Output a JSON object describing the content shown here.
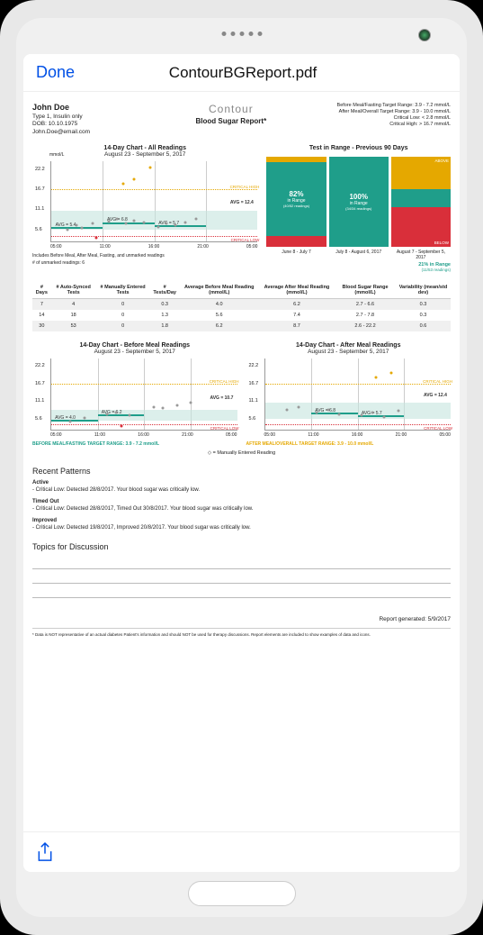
{
  "header": {
    "done": "Done",
    "title": "ContourBGReport.pdf"
  },
  "patient": {
    "name": "John Doe",
    "type": "Type 1, Insulin only",
    "dob": "DOB: 10.10.1975",
    "email": "John.Doe@email.com"
  },
  "brand": {
    "logo": "Contour",
    "subtitle": "Blood Sugar Report*"
  },
  "targets": {
    "before": "Before Meal/Fasting Target Range:  3.9 - 7.2 mmol/L",
    "after": "After Meal/Overall Target Range:  3.9 - 10.0 mmol/L",
    "low": "Critical Low:  < 2.8 mmol/L",
    "high": "Critical High:  > 16.7 mmol/L"
  },
  "chart_all": {
    "title": "14-Day Chart - All Readings",
    "subtitle": "August 23 - September 5, 2017",
    "unit": "mmol/L",
    "note1": "Includes Before Meal, After Meal, Fasting, and unmarked readings",
    "note2": "# of unmarked readings:  6",
    "crit_high": "CRITICAL HIGH",
    "crit_low": "CRITICAL LOW",
    "avg_label": "AVG = 12.4"
  },
  "chart_range": {
    "title": "Test in Range - Previous 90 Days",
    "col1": {
      "pct": "82%",
      "sub": "in Range",
      "small": "(40/52 readings)",
      "label": "June 8 - July 7"
    },
    "col2": {
      "pct": "100%",
      "sub": "in Range",
      "small": "(34/34 readings)",
      "label": "July 8 - August 6, 2017"
    },
    "col3": {
      "above": "ABOVE",
      "below": "BELOW",
      "label": "August 7 - September 5, 2017"
    },
    "note": "21% in Range",
    "note2": "(11/53 readings)"
  },
  "table": {
    "headers": [
      "# Days",
      "# Auto-Synced Tests",
      "# Manually Entered Tests",
      "# Tests/Day",
      "Average Before Meal Reading (mmol/L)",
      "Average After Meal Reading (mmol/L)",
      "Blood Sugar Range (mmol/L)",
      "Variability (mean/std dev)"
    ],
    "rows": [
      [
        "7",
        "4",
        "0",
        "0.3",
        "4.0",
        "6.2",
        "2.7 - 6.6",
        "0.3"
      ],
      [
        "14",
        "18",
        "0",
        "1.3",
        "5.6",
        "7.4",
        "2.7 - 7.8",
        "0.3"
      ],
      [
        "30",
        "53",
        "0",
        "1.8",
        "6.2",
        "8.7",
        "2.6 - 22.2",
        "0.6"
      ]
    ]
  },
  "chart_before": {
    "title": "14-Day Chart - Before Meal Readings",
    "subtitle": "August 23 - September 5, 2017",
    "crit_high": "CRITICAL HIGH",
    "crit_low": "CRITICAL LOW",
    "avg_label": "AVG = 10.7",
    "note": "BEFORE MEAL/FASTING TARGET RANGE: 3.9 - 7.2 mmol/L"
  },
  "chart_after": {
    "title": "14-Day Chart - After Meal Readings",
    "subtitle": "August 23 - September 5, 2017",
    "crit_high": "CRITICAL HIGH",
    "crit_low": "CRITICAL LOW",
    "avg_label": "AVG = 12.4",
    "note": "AFTER MEAL/OVERALL TARGET RANGE: 3.9 - 10.0 mmol/L"
  },
  "legend": "◇ = Manually Entered Reading",
  "patterns": {
    "title": "Recent Patterns",
    "active_h": "Active",
    "active_t": "- Critical Low:  Detected  28/8/2017.  Your blood sugar was critically low.",
    "timed_h": "Timed Out",
    "timed_t": "- Critical Low:  Detected  28/8/2017,  Timed Out  30/8/2017.  Your blood sugar was critically low.",
    "improved_h": "Improved",
    "improved_t": "- Critical Low:  Detected  19/8/2017,  Improved  20/8/2017.  Your blood sugar was critically low."
  },
  "discussion": {
    "title": "Topics for Discussion"
  },
  "generated": "Report generated:  5/9/2017",
  "disclaimer": "* Data is NOT representative of an actual diabetes Patient's information and should NOT be used for therapy discussions.  Report elements are included to show examples of data and icons.",
  "chart_data": [
    {
      "type": "scatter",
      "name": "14-Day Chart - All Readings",
      "xlabel": "time",
      "ylabel": "mmol/L",
      "x_ticks": [
        "05:00",
        "11:00",
        "16:00",
        "21:00",
        "05:00"
      ],
      "y_ticks": [
        5.6,
        11.1,
        16.7,
        22.2
      ],
      "critical_high": 16.7,
      "critical_low": 2.8,
      "target_band": [
        3.9,
        10.0
      ],
      "avg_segments": [
        {
          "label": "AVG = 5.4",
          "start": "05:00",
          "end": "11:00",
          "value": 5.4
        },
        {
          "label": "AVG = 6.8",
          "start": "11:00",
          "end": "16:00",
          "value": 6.8
        },
        {
          "label": "AVG = 5.7",
          "start": "16:00",
          "end": "21:00",
          "value": 5.7
        }
      ],
      "points_est": [
        [
          6,
          4
        ],
        [
          7,
          5
        ],
        [
          8,
          6
        ],
        [
          9,
          5
        ],
        [
          10,
          7
        ],
        [
          11,
          7
        ],
        [
          12,
          8
        ],
        [
          13,
          6
        ],
        [
          14,
          6
        ],
        [
          15,
          7
        ],
        [
          16,
          5
        ],
        [
          17,
          6
        ],
        [
          18,
          6
        ],
        [
          19,
          5
        ],
        [
          20,
          8
        ],
        [
          12,
          17
        ],
        [
          13,
          18
        ],
        [
          14,
          22
        ],
        [
          9,
          2.7
        ]
      ]
    },
    {
      "type": "bar",
      "name": "Test in Range - Previous 90 Days",
      "categories": [
        "June 8 - July 7",
        "July 8 - August 6, 2017",
        "August 7 - September 5, 2017"
      ],
      "series": [
        {
          "name": "in Range %",
          "values": [
            82,
            100,
            21
          ]
        },
        {
          "name": "readings_in_range",
          "values": [
            40,
            34,
            11
          ]
        },
        {
          "name": "readings_total",
          "values": [
            52,
            34,
            53
          ]
        }
      ]
    },
    {
      "type": "scatter",
      "name": "14-Day Chart - Before Meal Readings",
      "x_ticks": [
        "05:00",
        "11:00",
        "16:00",
        "21:00",
        "05:00"
      ],
      "y_ticks": [
        5.6,
        11.1,
        16.7,
        22.2
      ],
      "critical_high": 16.7,
      "critical_low": 2.8,
      "target_band": [
        3.9,
        7.2
      ],
      "avg_segments": [
        {
          "label": "AVG = 4.0",
          "value": 4.0
        },
        {
          "label": "AVG = 6.2",
          "value": 6.2
        }
      ],
      "overall_avg": 10.7
    },
    {
      "type": "scatter",
      "name": "14-Day Chart - After Meal Readings",
      "x_ticks": [
        "05:00",
        "11:00",
        "16:00",
        "21:00",
        "05:00"
      ],
      "y_ticks": [
        5.6,
        11.1,
        16.7,
        22.2
      ],
      "critical_high": 16.7,
      "critical_low": 2.8,
      "target_band": [
        3.9,
        10.0
      ],
      "avg_segments": [
        {
          "label": "AVG = 6.8",
          "value": 6.8
        },
        {
          "label": "AVG = 5.7",
          "value": 5.7
        }
      ],
      "overall_avg": 12.4
    },
    {
      "type": "table",
      "name": "summary",
      "headers": [
        "# Days",
        "# Auto-Synced Tests",
        "# Manually Entered Tests",
        "# Tests/Day",
        "Average Before Meal",
        "Average After Meal",
        "Blood Sugar Range",
        "Variability"
      ],
      "rows": [
        [
          "7",
          4,
          0,
          0.3,
          4.0,
          6.2,
          "2.7 - 6.6",
          0.3
        ],
        [
          "14",
          18,
          0,
          1.3,
          5.6,
          7.4,
          "2.7 - 7.8",
          0.3
        ],
        [
          "30",
          53,
          0,
          1.8,
          6.2,
          8.7,
          "2.6 - 22.2",
          0.6
        ]
      ]
    }
  ],
  "avg_labels": {
    "a1": "AVG = 5.4",
    "a2": "AVG = 6.8",
    "a3": "AVG = 5.7",
    "b1": "AVG = 4.0",
    "b2": "AVG = 6.2",
    "c1": "AVG = 6.8",
    "c2": "AVG = 5.7"
  },
  "yticks": {
    "y1": "5.6",
    "y2": "11.1",
    "y3": "16.7",
    "y4": "22.2"
  },
  "xticks": {
    "x1": "05:00",
    "x2": "11:00",
    "x3": "16:00",
    "x4": "21:00",
    "x5": "05:00"
  }
}
